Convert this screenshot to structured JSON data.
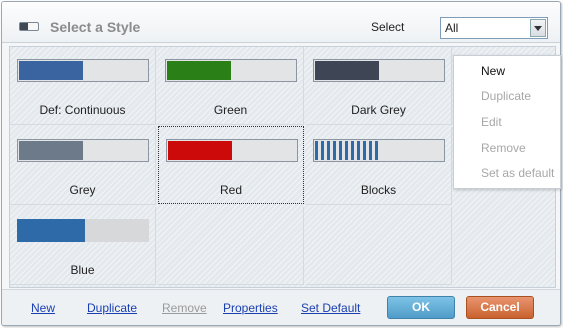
{
  "header": {
    "title": "Select a Style",
    "select_label": "Select",
    "filter_value": "All"
  },
  "styles": [
    {
      "label": "Def: Continuous",
      "color": "#3a64a0",
      "kind": "bar"
    },
    {
      "label": "Green",
      "color": "#2a7f17",
      "kind": "bar"
    },
    {
      "label": "Dark Grey",
      "color": "#3e4554",
      "kind": "bar"
    },
    {
      "label": "Grey",
      "color": "#6d7a89",
      "kind": "bar"
    },
    {
      "label": "Red",
      "color": "#cc0a0a",
      "kind": "bar",
      "selected": true
    },
    {
      "label": "Blocks",
      "color": "#2f6aa8",
      "kind": "blocks"
    },
    {
      "label": "Blue",
      "color": "#2f6aa8",
      "kind": "flat"
    }
  ],
  "context_menu": {
    "items": [
      {
        "label": "New",
        "enabled": true
      },
      {
        "label": "Duplicate",
        "enabled": false
      },
      {
        "label": "Edit",
        "enabled": false
      },
      {
        "label": "Remove",
        "enabled": false
      },
      {
        "label": "Set as default",
        "enabled": false
      }
    ]
  },
  "footer": {
    "links": [
      {
        "label": "New",
        "enabled": true
      },
      {
        "label": "Duplicate",
        "enabled": true
      },
      {
        "label": "Remove",
        "enabled": false
      },
      {
        "label": "Properties",
        "enabled": true
      },
      {
        "label": "Set Default",
        "enabled": true
      }
    ],
    "ok_label": "OK",
    "cancel_label": "Cancel"
  }
}
